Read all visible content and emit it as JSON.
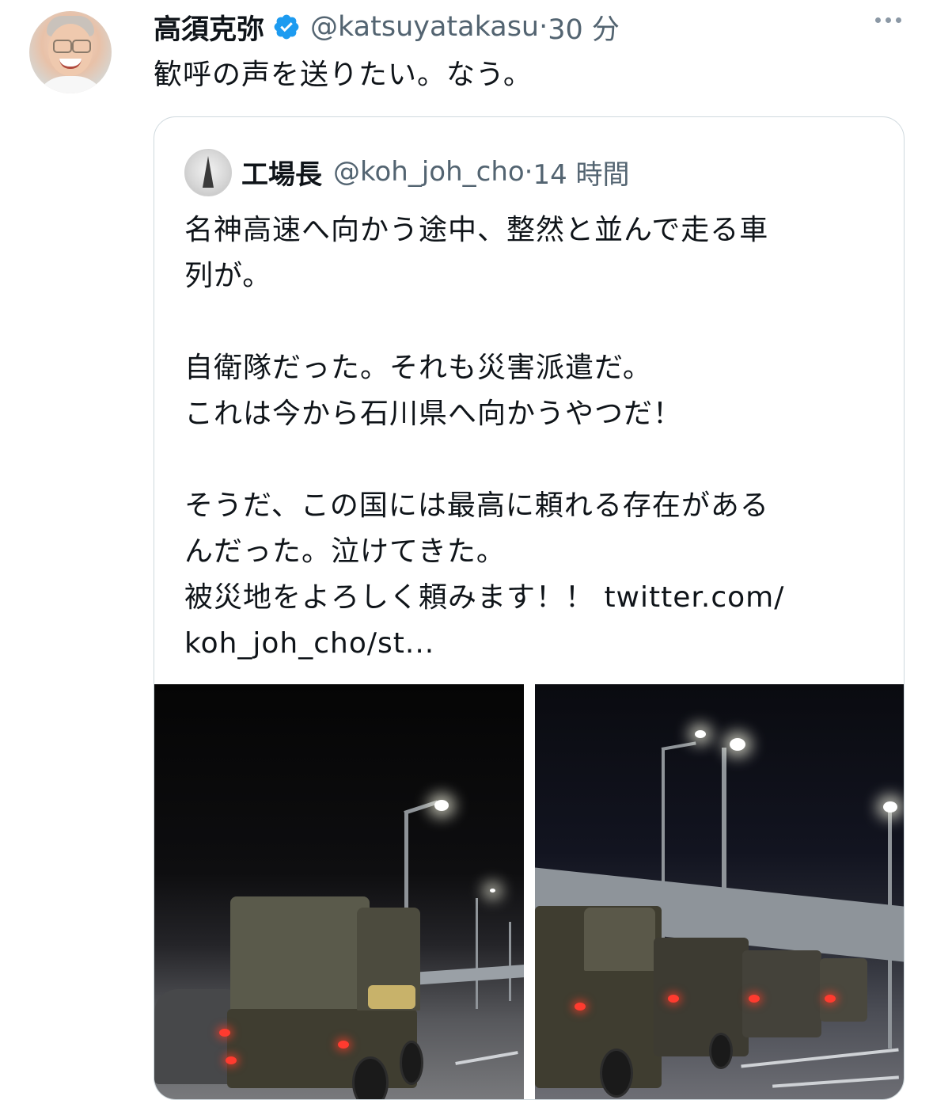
{
  "tweet": {
    "author_name": "高須克弥",
    "author_handle": "@katsuyatakasu",
    "separator": " · ",
    "time": "30 分",
    "text": "歓呼の声を送りたい。なう。"
  },
  "quoted_tweet": {
    "author_name": "工場長",
    "author_handle": "@koh_joh_cho",
    "separator": " · ",
    "time": "14 時間",
    "text": "名神高速へ向かう途中、整然と並んで走る車\n列が。\n\n自衛隊だった。それも災害派遣だ。\nこれは今から石川県へ向かうやつだ！\n\nそうだ、この国には最高に頼れる存在がある\nんだった。泣けてきた。\n被災地をよろしく頼みます！！ twitter.com/\nkoh_joh_cho/st..."
  },
  "colors": {
    "text_primary": "#0f1419",
    "text_secondary": "#536471",
    "verified_blue": "#1d9bf0",
    "border": "#cfd9de"
  },
  "icons": {
    "verified": "verified-badge-icon",
    "more": "more-horizontal-icon"
  }
}
